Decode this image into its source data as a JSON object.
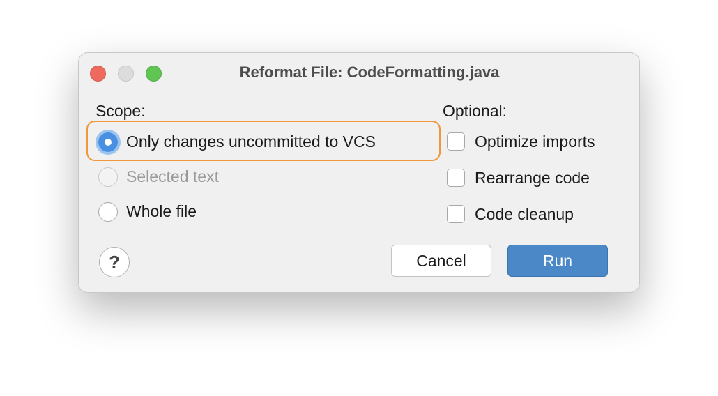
{
  "window": {
    "title": "Reformat File: CodeFormatting.java"
  },
  "scope": {
    "label": "Scope:",
    "options": [
      {
        "label": "Only changes uncommitted to VCS",
        "selected": true,
        "enabled": true
      },
      {
        "label": "Selected text",
        "selected": false,
        "enabled": false
      },
      {
        "label": "Whole file",
        "selected": false,
        "enabled": true
      }
    ]
  },
  "optional": {
    "label": "Optional:",
    "options": [
      {
        "label": "Optimize imports",
        "checked": false
      },
      {
        "label": "Rearrange code",
        "checked": false
      },
      {
        "label": "Code cleanup",
        "checked": false
      }
    ]
  },
  "buttons": {
    "help": "?",
    "cancel": "Cancel",
    "run": "Run"
  },
  "colors": {
    "accent": "#4a88c7",
    "highlight": "#f0973a"
  }
}
